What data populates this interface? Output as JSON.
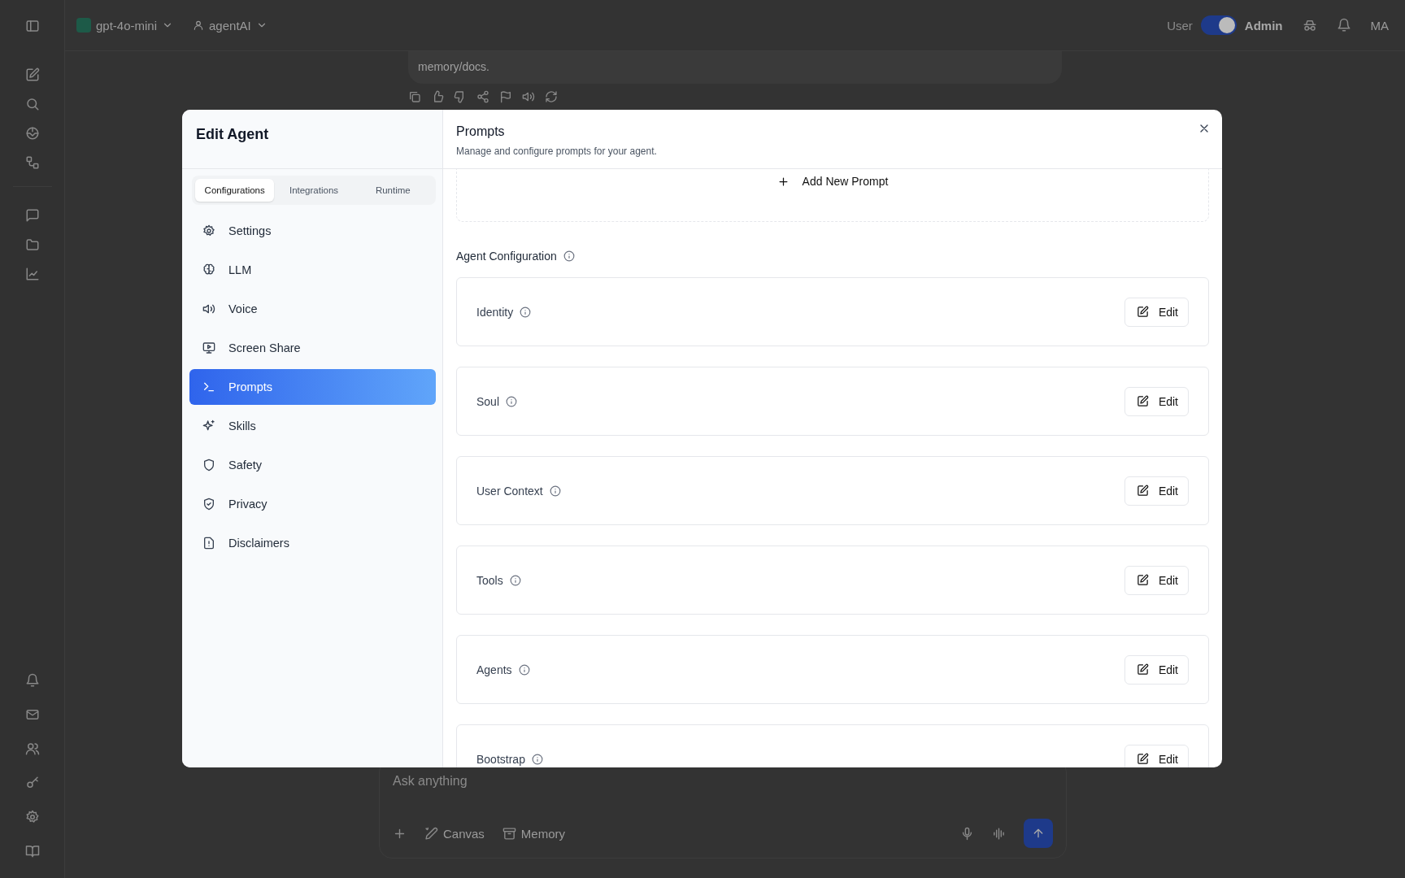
{
  "top_bar": {
    "model": "gpt-4o-mini",
    "agent": "agentAI",
    "role_toggle": {
      "left_label": "User",
      "right_label": "Admin",
      "on": true
    },
    "avatar": "MA"
  },
  "chat": {
    "message_tail": "memory/docs.",
    "input": {
      "placeholder": "Ask anything"
    },
    "tools": [
      "Canvas",
      "Memory"
    ]
  },
  "modal": {
    "title": "Edit Agent",
    "tabs": [
      {
        "label": "Configurations",
        "selected": true
      },
      {
        "label": "Integrations",
        "selected": false
      },
      {
        "label": "Runtime",
        "selected": false
      }
    ],
    "nav": [
      {
        "label": "Settings",
        "selected": false
      },
      {
        "label": "LLM",
        "selected": false
      },
      {
        "label": "Voice",
        "selected": false
      },
      {
        "label": "Screen Share",
        "selected": false
      },
      {
        "label": "Prompts",
        "selected": true
      },
      {
        "label": "Skills",
        "selected": false
      },
      {
        "label": "Safety",
        "selected": false
      },
      {
        "label": "Privacy",
        "selected": false
      },
      {
        "label": "Disclaimers",
        "selected": false
      }
    ],
    "panel": {
      "title": "Prompts",
      "subtitle": "Manage and configure prompts for your agent.",
      "add_button": "Add New Prompt",
      "section": "Agent Configuration",
      "cards": [
        {
          "label": "Identity",
          "button": "Edit"
        },
        {
          "label": "Soul",
          "button": "Edit"
        },
        {
          "label": "User Context",
          "button": "Edit"
        },
        {
          "label": "Tools",
          "button": "Edit"
        },
        {
          "label": "Agents",
          "button": "Edit"
        },
        {
          "label": "Bootstrap",
          "button": "Edit"
        }
      ]
    }
  }
}
